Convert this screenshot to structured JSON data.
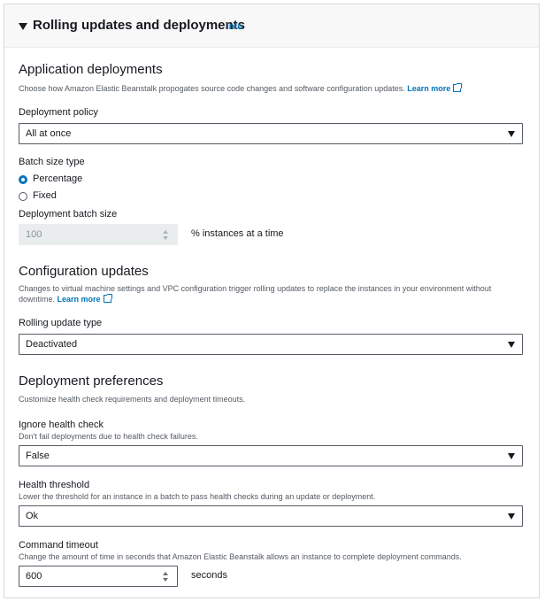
{
  "header": {
    "title": "Rolling updates and deployments",
    "info": "Info"
  },
  "application_deployments": {
    "title": "Application deployments",
    "description": "Choose how Amazon Elastic Beanstalk propogates source code changes and software configuration updates.",
    "learn_more": "Learn more",
    "deployment_policy": {
      "label": "Deployment policy",
      "value": "All at once"
    },
    "batch_size_type": {
      "label": "Batch size type",
      "options": [
        {
          "label": "Percentage",
          "selected": true
        },
        {
          "label": "Fixed",
          "selected": false
        }
      ]
    },
    "batch_size": {
      "label": "Deployment batch size",
      "value": "100",
      "suffix": "% instances at a time",
      "disabled": true
    }
  },
  "configuration_updates": {
    "title": "Configuration updates",
    "description_line1": "Changes to virtual machine settings and VPC configuration trigger rolling updates to replace the instances in your environment without",
    "description_line2": "downtime.",
    "learn_more": "Learn more",
    "rolling_update_type": {
      "label": "Rolling update type",
      "value": "Deactivated"
    }
  },
  "deployment_preferences": {
    "title": "Deployment preferences",
    "description": "Customize health check requirements and deployment timeouts.",
    "ignore_health_check": {
      "label": "Ignore health check",
      "description": "Don't fail deployments due to health check failures.",
      "value": "False"
    },
    "health_threshold": {
      "label": "Health threshold",
      "description": "Lower the threshold for an instance in a batch to pass health checks during an update or deployment.",
      "value": "Ok"
    },
    "command_timeout": {
      "label": "Command timeout",
      "description": "Change the amount of time in seconds that Amazon Elastic Beanstalk allows an instance to complete deployment commands.",
      "value": "600",
      "suffix": "seconds"
    }
  },
  "colors": {
    "link": "#0073bb",
    "text": "#16191f",
    "muted": "#545b64",
    "border": "#d5dbdb"
  }
}
